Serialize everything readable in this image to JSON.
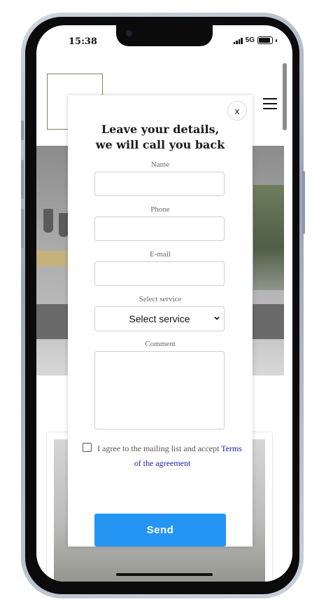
{
  "status_bar": {
    "time": "15:38",
    "network": "5G",
    "signal_icon": "signal-bars-icon",
    "battery_icon": "battery-icon"
  },
  "header": {
    "menu_icon": "hamburger-menu-icon"
  },
  "modal": {
    "close_label": "x",
    "title_line1": "Leave your details,",
    "title_line2": "we will call you back",
    "fields": {
      "name_label": "Name",
      "name_value": "",
      "phone_label": "Phone",
      "phone_value": "",
      "email_label": "E-mail",
      "email_value": "",
      "service_label": "Select service",
      "service_selected": "Select service",
      "comment_label": "Comment",
      "comment_value": ""
    },
    "agree_text_before": "I agree to the mailing list and accept ",
    "agree_link": "Terms of the agreement",
    "agree_checked": false,
    "send_label": "Send",
    "accent_color": "#2595f3"
  }
}
